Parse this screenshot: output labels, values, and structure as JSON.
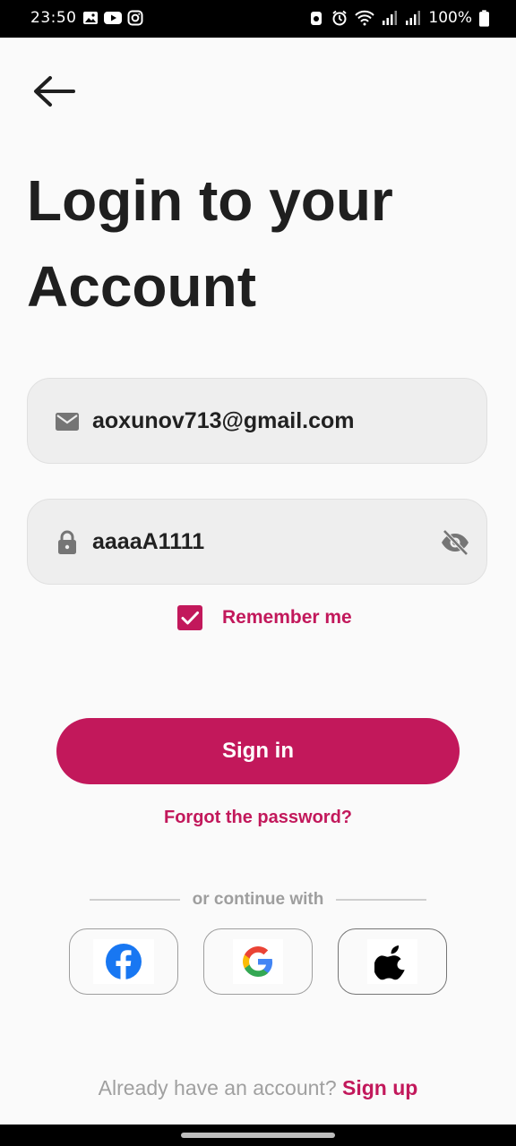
{
  "status_bar": {
    "time": "23:50",
    "battery": "100%",
    "icons": [
      "gallery-icon",
      "youtube-icon",
      "instagram-icon",
      "recycle-icon",
      "alarm-icon",
      "wifi-icon",
      "signal-icon",
      "signal-icon",
      "battery-icon"
    ]
  },
  "title_line1": "Login to your",
  "title_line2": "Account",
  "email": {
    "value": "aoxunov713@gmail.com",
    "icon": "mail-icon"
  },
  "password": {
    "value": "aaaaA1111",
    "icon": "lock-icon",
    "toggle_icon": "eye-off-icon"
  },
  "remember": {
    "label": "Remember me",
    "checked": true
  },
  "signin_label": "Sign in",
  "forgot_label": "Forgot the password?",
  "divider_text": "or continue  with",
  "social": [
    "facebook-icon",
    "google-icon",
    "apple-icon"
  ],
  "footer": {
    "prompt": "Already have an account?",
    "link": "Sign up"
  },
  "colors": {
    "accent": "#c2185b",
    "field_bg": "#eeeeee",
    "background": "#fafafa"
  }
}
